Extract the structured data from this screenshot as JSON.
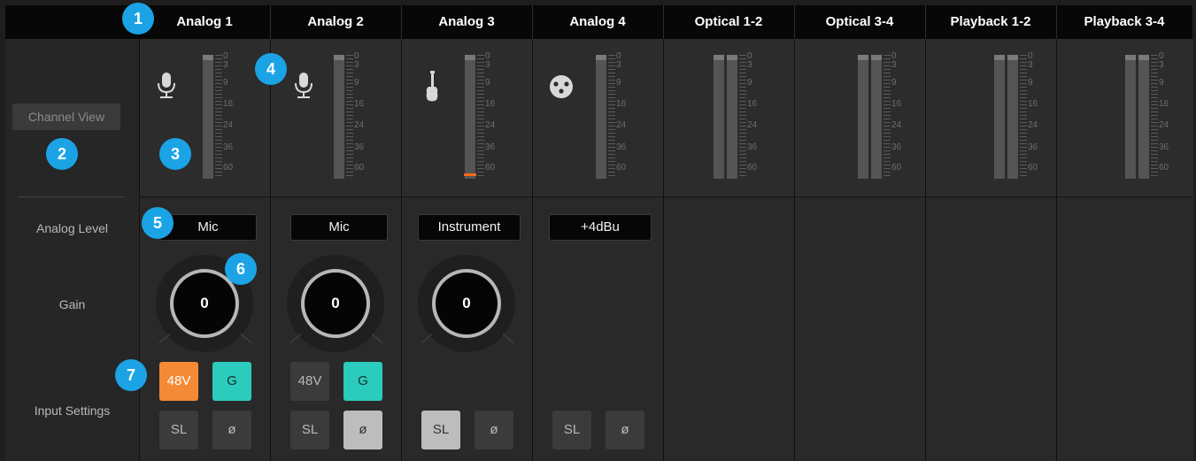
{
  "header": {
    "channels": [
      "Analog 1",
      "Analog 2",
      "Analog 3",
      "Analog 4",
      "Optical 1-2",
      "Optical 3-4",
      "Playback 1-2",
      "Playback 3-4"
    ]
  },
  "sidebar": {
    "channel_view": "Channel View",
    "analog_level": "Analog Level",
    "gain": "Gain",
    "input_settings": "Input Settings"
  },
  "meter_scale": [
    "0",
    "3",
    "9",
    "16",
    "24",
    "36",
    "60"
  ],
  "channels": [
    {
      "name": "Analog 1",
      "icon": "microphone-icon",
      "level": "Mic",
      "gain": "0",
      "phantom": "48V",
      "ground": "G",
      "solo": "SL",
      "phase": "ø",
      "phantom_on": true,
      "ground_on": true,
      "solo_on": false,
      "phase_on": false
    },
    {
      "name": "Analog 2",
      "icon": "microphone-icon",
      "level": "Mic",
      "gain": "0",
      "phantom": "48V",
      "ground": "G",
      "solo": "SL",
      "phase": "ø",
      "phantom_on": false,
      "ground_on": true,
      "solo_on": false,
      "phase_on": true
    },
    {
      "name": "Analog 3",
      "icon": "guitar-icon",
      "level": "Instrument",
      "gain": "0",
      "solo": "SL",
      "phase": "ø",
      "solo_on": true,
      "phase_on": false,
      "peak_level": 0.05
    },
    {
      "name": "Analog 4",
      "icon": "xlr-connector-icon",
      "level": "+4dBu",
      "solo": "SL",
      "phase": "ø",
      "solo_on": false,
      "phase_on": false
    }
  ],
  "callouts": [
    "1",
    "2",
    "3",
    "4",
    "5",
    "6",
    "7"
  ],
  "colors": {
    "callout": "#1ba3e6",
    "phantom_active": "#f58a36",
    "ground_active": "#2bcbbd",
    "peak": "#ff6a13"
  }
}
